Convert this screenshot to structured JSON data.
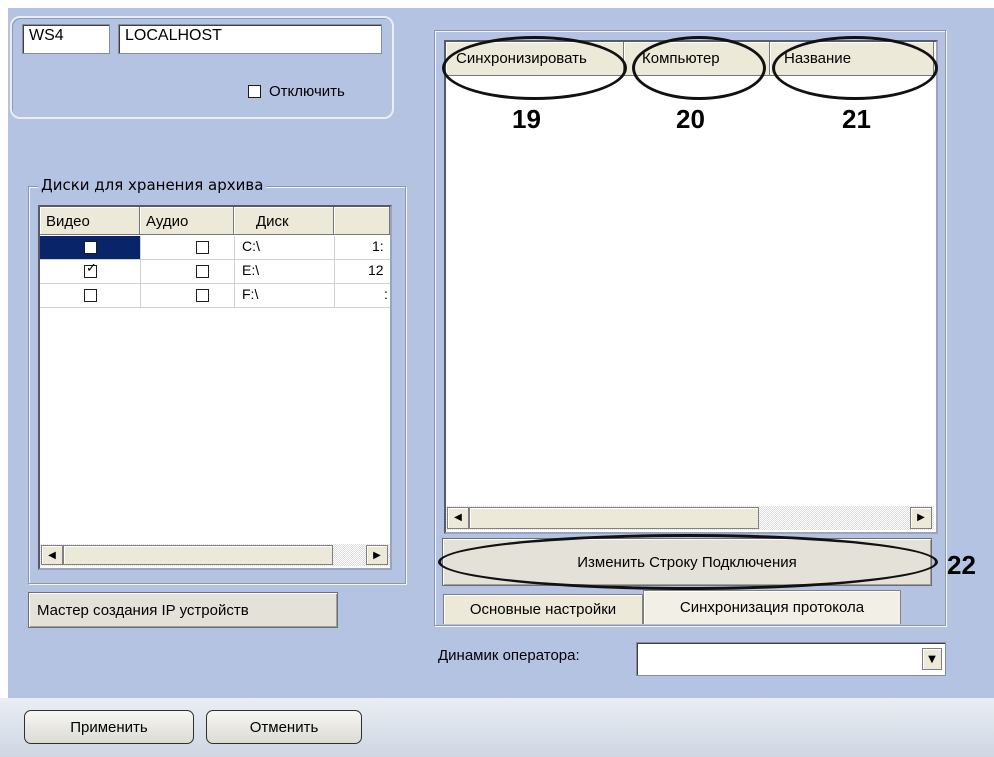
{
  "server": {
    "id_value": "WS4",
    "host_value": "LOCALHOST",
    "disable_label": "Отключить",
    "disable_checked": false
  },
  "disks": {
    "group_title": "Диски для хранения архива",
    "columns": [
      "Видео",
      "Аудио",
      "Диск"
    ],
    "rows": [
      {
        "video": false,
        "audio": false,
        "disk": "C:\\",
        "extra": "1:"
      },
      {
        "video": true,
        "audio": false,
        "disk": "E:\\",
        "extra": "12"
      },
      {
        "video": false,
        "audio": false,
        "disk": "F:\\",
        "extra": ":"
      }
    ]
  },
  "wizard_button": "Мастер создания IP устройств",
  "sync": {
    "columns": [
      "Синхронизировать",
      "Компьютер",
      "Название"
    ],
    "callouts": [
      "19",
      "20",
      "21"
    ],
    "change_button": "Изменить Строку Подключения",
    "change_callout": "22"
  },
  "tabs": [
    "Основные настройки",
    "Синхронизация протокола"
  ],
  "active_tab": 1,
  "speaker": {
    "label": "Динамик оператора:",
    "value": ""
  },
  "footer": {
    "apply": "Применить",
    "cancel": "Отменить"
  },
  "colors": {
    "panel_bg": "#b5c3e3",
    "callout_ring": "#111111"
  }
}
